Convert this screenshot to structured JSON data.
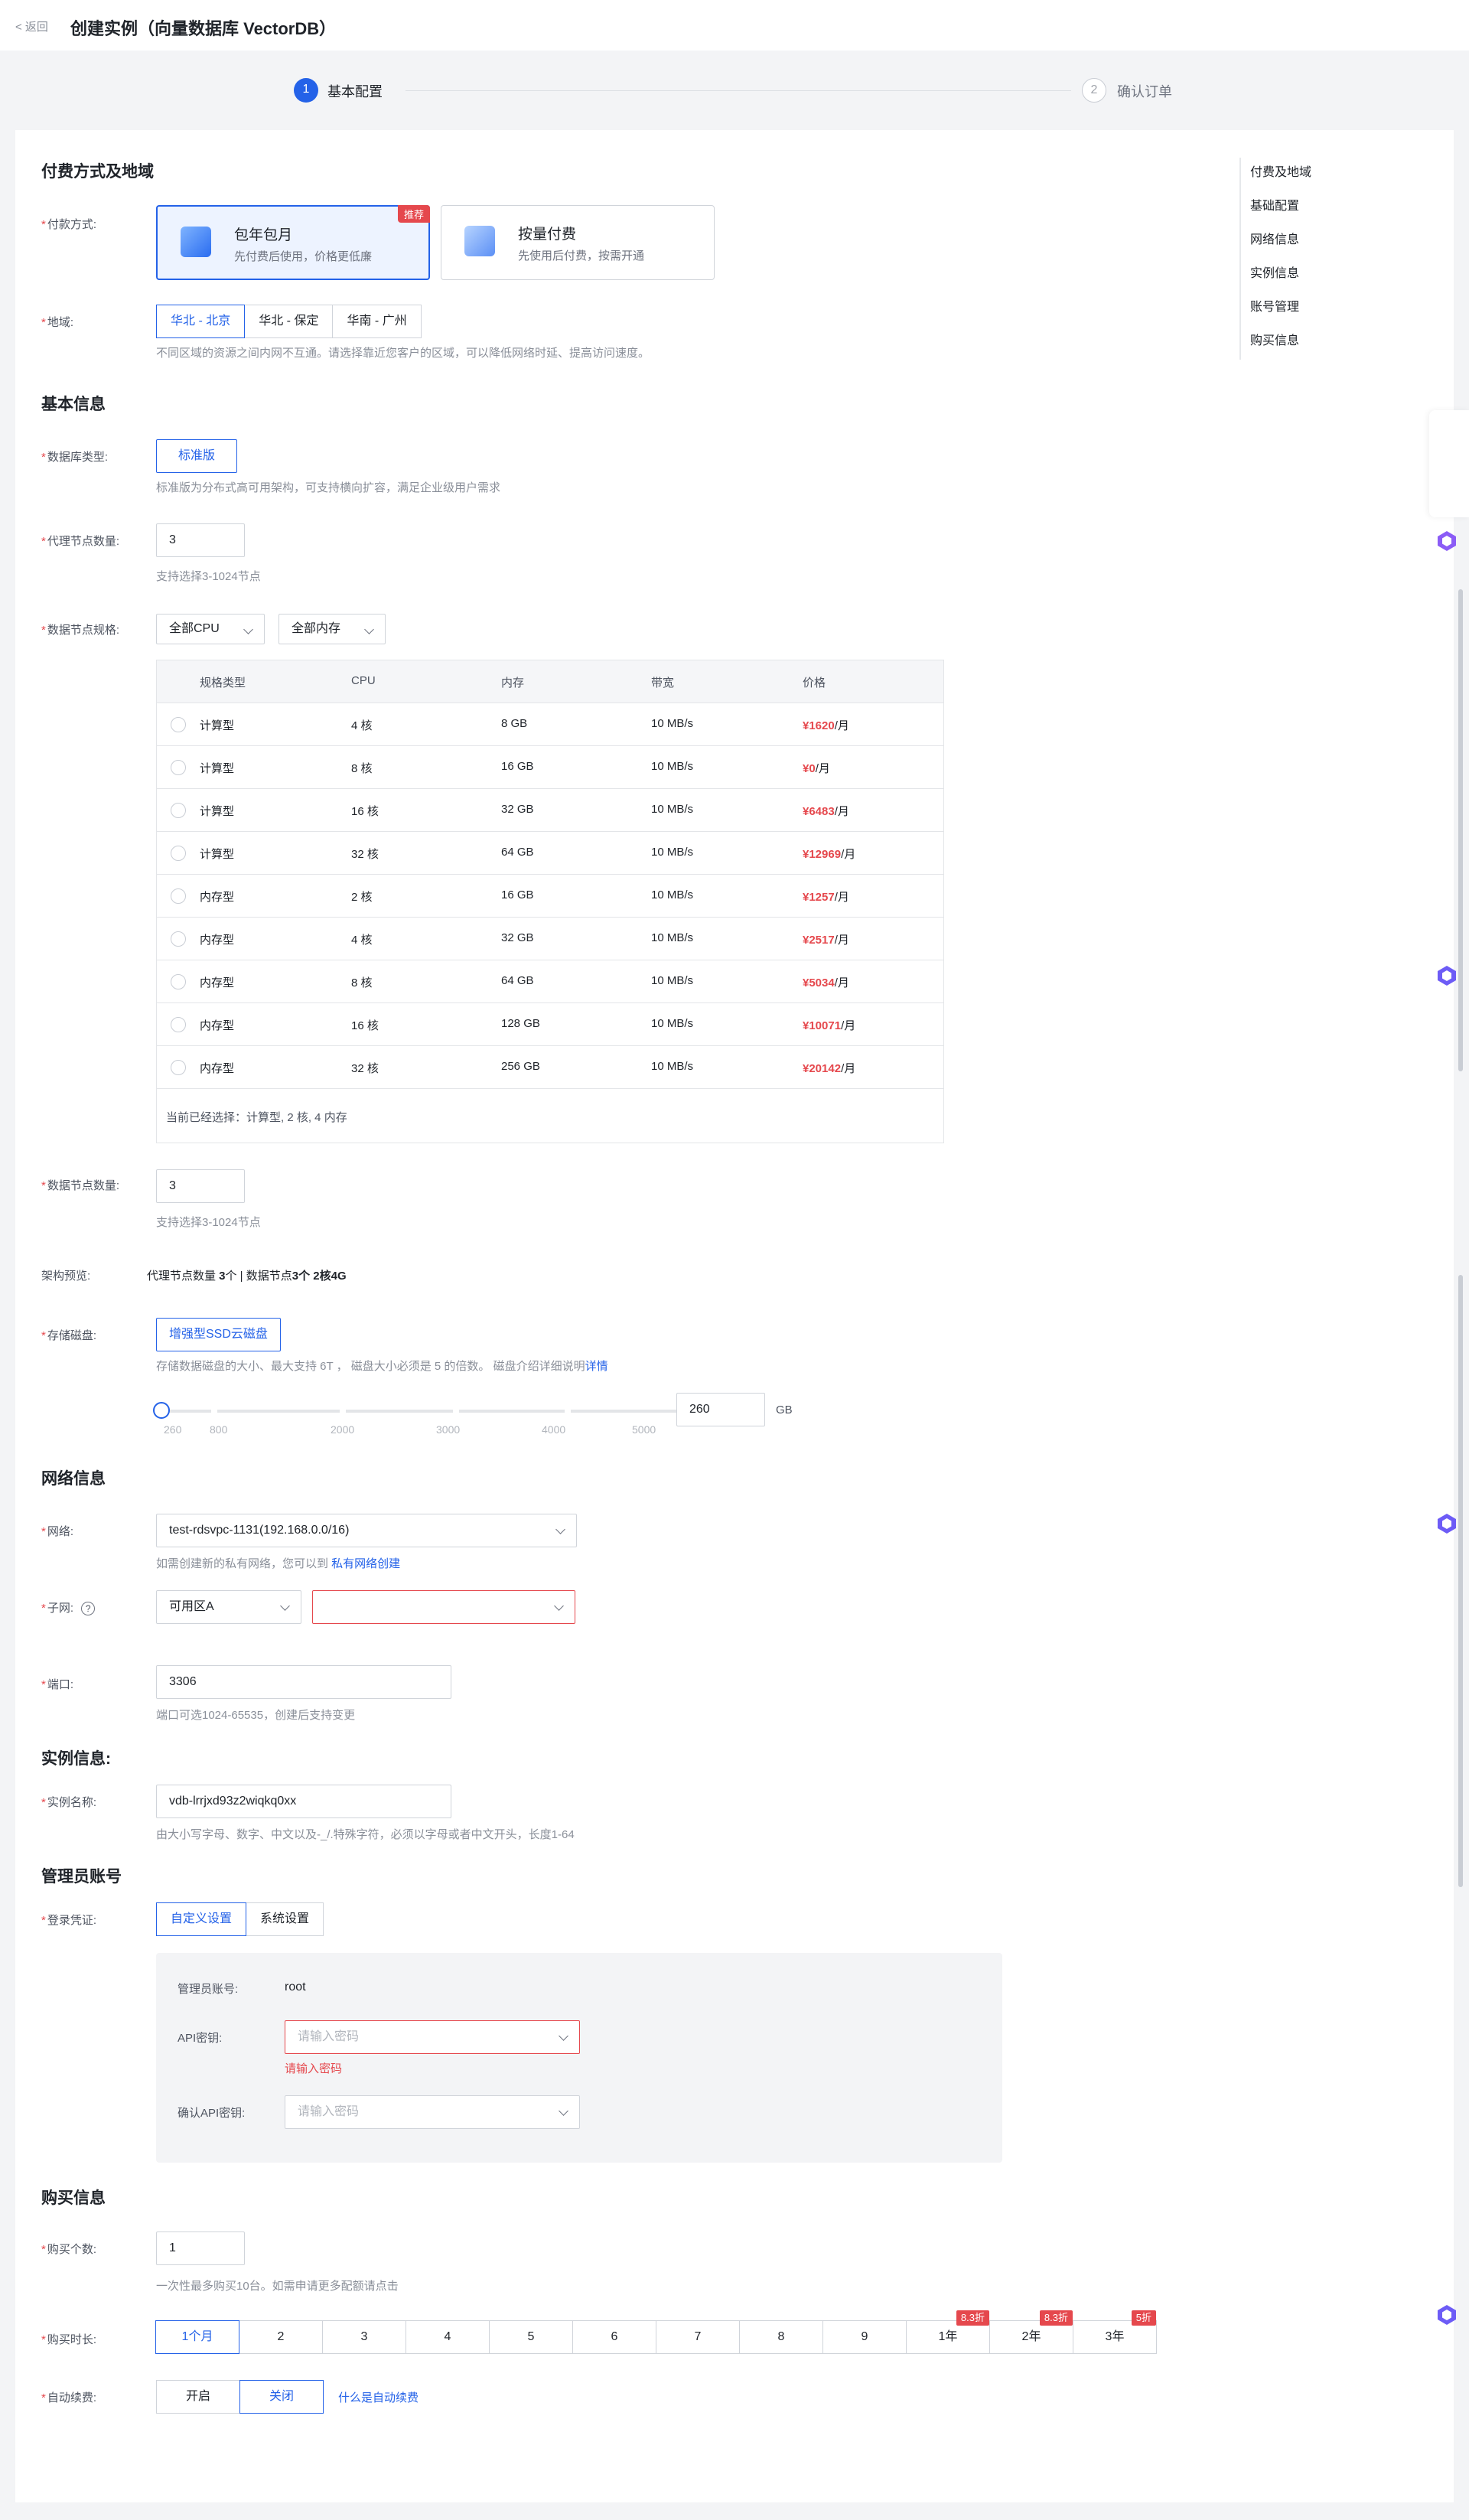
{
  "header": {
    "back": "< 返回",
    "title": "创建实例（向量数据库 VectorDB）"
  },
  "steps": [
    {
      "num": "1",
      "label": "基本配置"
    },
    {
      "num": "2",
      "label": "确认订单"
    }
  ],
  "anchors": [
    "付费及地域",
    "基础配置",
    "网络信息",
    "实例信息",
    "账号管理",
    "购买信息"
  ],
  "billing": {
    "section": "付费方式及地域",
    "label": "付款方式:",
    "options": [
      {
        "title": "包年包月",
        "desc": "先付费后使用，价格更低廉",
        "badge": "推荐"
      },
      {
        "title": "按量付费",
        "desc": "先使用后付费，按需开通"
      }
    ],
    "region_label": "地域:",
    "regions": [
      "华北 - 北京",
      "华北 - 保定",
      "华南 - 广州"
    ],
    "region_hint": "不同区域的资源之间内网不互通。请选择靠近您客户的区域，可以降低网络时延、提高访问速度。"
  },
  "basic": {
    "section": "基本信息",
    "dbtype_label": "数据库类型:",
    "dbtype": "标准版",
    "dbtype_hint": "标准版为分布式高可用架构，可支持横向扩容，满足企业级用户需求",
    "proxy_label": "代理节点数量:",
    "proxy_value": "3",
    "proxy_hint": "支持选择3-1024节点",
    "spec_label": "数据节点规格:",
    "cpu_filter": "全部CPU",
    "mem_filter": "全部内存",
    "columns": [
      "规格类型",
      "CPU",
      "内存",
      "带宽",
      "价格"
    ],
    "rows": [
      [
        "计算型",
        "4 核",
        "8 GB",
        "10 MB/s",
        "¥1620",
        "/月"
      ],
      [
        "计算型",
        "8 核",
        "16 GB",
        "10 MB/s",
        "¥0",
        "/月"
      ],
      [
        "计算型",
        "16 核",
        "32 GB",
        "10 MB/s",
        "¥6483",
        "/月"
      ],
      [
        "计算型",
        "32 核",
        "64 GB",
        "10 MB/s",
        "¥12969",
        "/月"
      ],
      [
        "内存型",
        "2 核",
        "16 GB",
        "10 MB/s",
        "¥1257",
        "/月"
      ],
      [
        "内存型",
        "4 核",
        "32 GB",
        "10 MB/s",
        "¥2517",
        "/月"
      ],
      [
        "内存型",
        "8 核",
        "64 GB",
        "10 MB/s",
        "¥5034",
        "/月"
      ],
      [
        "内存型",
        "16 核",
        "128 GB",
        "10 MB/s",
        "¥10071",
        "/月"
      ],
      [
        "内存型",
        "32 核",
        "256 GB",
        "10 MB/s",
        "¥20142",
        "/月"
      ]
    ],
    "selected_text": "当前已经选择：计算型, 2 核, 4 内存",
    "datanode_label": "数据节点数量:",
    "datanode_value": "3",
    "datanode_hint": "支持选择3-1024节点",
    "arch_label": "架构预览:",
    "arch_a": "代理节点数量 ",
    "arch_b": "3",
    "arch_c": "个 | 数据节点",
    "arch_d": "3个 2核4G",
    "disk_label": "存储磁盘:",
    "disk_type": "增强型SSD云磁盘",
    "disk_hint": "存储数据磁盘的大小、最大支持 6T ， 磁盘大小必须是 5 的倍数。 磁盘介绍详细说明",
    "disk_link": "详情",
    "slider_ticks": [
      "260",
      "800",
      "2000",
      "3000",
      "4000",
      "5000"
    ],
    "disk_value": "260",
    "disk_unit": "GB"
  },
  "network": {
    "section": "网络信息",
    "net_label": "网络:",
    "net_value": "test-rdsvpc-1131(192.168.0.0/16)",
    "net_hint": "如需创建新的私有网络，您可以到 ",
    "net_link": "私有网络创建",
    "subnet_label": "子网:",
    "subnet_zone": "可用区A",
    "subnet_value": "",
    "port_label": "端口:",
    "port_value": "3306",
    "port_hint": "端口可选1024-65535，创建后支持变更"
  },
  "instance": {
    "section": "实例信息:",
    "name_label": "实例名称:",
    "name_value": "vdb-lrrjxd93z2wiqkq0xx",
    "name_hint": "由大小写字母、数字、中文以及-_/.特殊字符，必须以字母或者中文开头，长度1-64"
  },
  "admin": {
    "section": "管理员账号",
    "cred_label": "登录凭证:",
    "cred_options": [
      "自定义设置",
      "系统设置"
    ],
    "account_label": "管理员账号:",
    "account_value": "root",
    "api_label": "API密钥:",
    "api_placeholder": "请输入密码",
    "api_error": "请输入密码",
    "confirm_label": "确认API密钥:",
    "confirm_placeholder": "请输入密码"
  },
  "purchase": {
    "section": "购买信息",
    "count_label": "购买个数:",
    "count_value": "1",
    "count_hint": "一次性最多购买10台。如需申请更多配额请点击",
    "duration_label": "购买时长:",
    "durations": [
      {
        "label": "1个月",
        "discount": ""
      },
      {
        "label": "2",
        "discount": ""
      },
      {
        "label": "3",
        "discount": ""
      },
      {
        "label": "4",
        "discount": ""
      },
      {
        "label": "5",
        "discount": ""
      },
      {
        "label": "6",
        "discount": ""
      },
      {
        "label": "7",
        "discount": ""
      },
      {
        "label": "8",
        "discount": ""
      },
      {
        "label": "9",
        "discount": ""
      },
      {
        "label": "1年",
        "discount": "8.3折"
      },
      {
        "label": "2年",
        "discount": "8.3折"
      },
      {
        "label": "3年",
        "discount": "5折"
      }
    ],
    "renew_label": "自动续费:",
    "renew_options": [
      "开启",
      "关闭"
    ],
    "renew_link": "什么是自动续费"
  },
  "colors": {
    "primary": "#2462e8",
    "danger": "#e5484d"
  }
}
